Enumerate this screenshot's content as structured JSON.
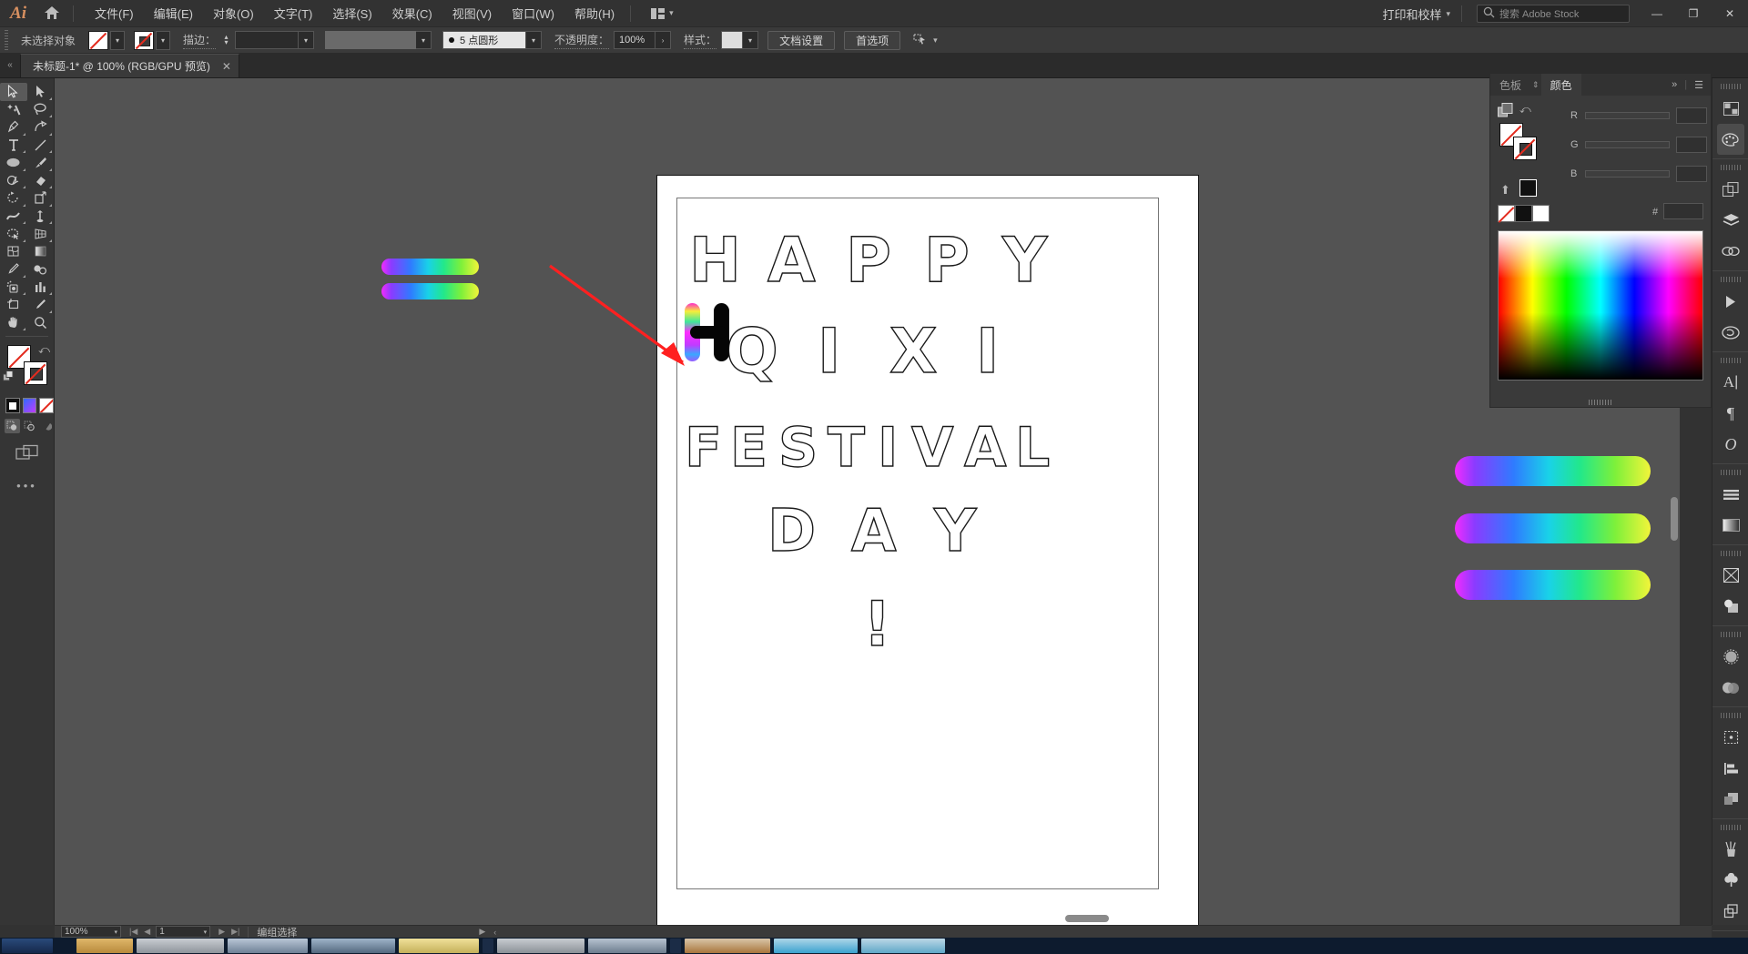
{
  "app": {
    "name": "Adobe Illustrator",
    "logo_text": "Ai"
  },
  "menubar": {
    "items": [
      {
        "label": "文件(F)",
        "name": "menu-file"
      },
      {
        "label": "编辑(E)",
        "name": "menu-edit"
      },
      {
        "label": "对象(O)",
        "name": "menu-object"
      },
      {
        "label": "文字(T)",
        "name": "menu-type"
      },
      {
        "label": "选择(S)",
        "name": "menu-select"
      },
      {
        "label": "效果(C)",
        "name": "menu-effect"
      },
      {
        "label": "视图(V)",
        "name": "menu-view"
      },
      {
        "label": "窗口(W)",
        "name": "menu-window"
      },
      {
        "label": "帮助(H)",
        "name": "menu-help"
      }
    ],
    "print_proof": "打印和校样",
    "search_placeholder": "搜索 Adobe Stock",
    "window_minimize": "—",
    "window_restore": "❐",
    "window_close": "✕"
  },
  "controlbar": {
    "selection_label": "未选择对象",
    "stroke_label": "描边：",
    "stroke_weight": "",
    "stroke_profile": "5 点圆形",
    "opacity_label": "不透明度：",
    "opacity_value": "100%",
    "style_label": "样式：",
    "document_setup": "文档设置",
    "preferences": "首选项"
  },
  "tabbar": {
    "document_title": "未标题-1* @ 100% (RGB/GPU 预览)",
    "close_glyph": "✕"
  },
  "color_panel": {
    "tabs": [
      {
        "label": "色板",
        "active": false
      },
      {
        "label": "颜色",
        "active": true
      }
    ],
    "channels": [
      {
        "label": "R",
        "value": ""
      },
      {
        "label": "G",
        "value": ""
      },
      {
        "label": "B",
        "value": ""
      }
    ],
    "hex_label": "#",
    "hex_value": "",
    "collapse_glyph": "»",
    "menu_glyph": "☰"
  },
  "artwork": {
    "lines": [
      {
        "text": "HAPPY",
        "chars": [
          "H",
          "A",
          "P",
          "P",
          "Y"
        ]
      },
      {
        "text": "QIXI",
        "chars": [
          "Q",
          "I",
          "X",
          "I"
        ]
      },
      {
        "text": "FESTIVAL",
        "chars": [
          "F",
          "E",
          "S",
          "T",
          "I",
          "V",
          "A",
          "L"
        ]
      },
      {
        "text": "DAY",
        "chars": [
          "D",
          "A",
          "Y"
        ]
      },
      {
        "text": "!",
        "chars": [
          "!"
        ]
      }
    ],
    "gradient_colors": [
      "#f32bff",
      "#8b3bff",
      "#2f7bff",
      "#19d2e8",
      "#22e88a",
      "#7ef03a",
      "#f2f53a"
    ],
    "annotation_arrow_color": "#ff2020",
    "selected_letter": "H"
  },
  "statusbar": {
    "zoom_level": "100%",
    "page_number": "1",
    "tool_status": "编组选择",
    "first_glyph": "|◀",
    "prev_glyph": "◀",
    "next_glyph": "▶",
    "last_glyph": "▶|"
  },
  "tools": {
    "left": [
      [
        "selection-tool",
        "direct-selection-tool"
      ],
      [
        "magic-wand-tool",
        "lasso-tool"
      ],
      [
        "pen-tool",
        "curvature-tool"
      ],
      [
        "type-tool",
        "line-segment-tool"
      ],
      [
        "ellipse-tool",
        "paintbrush-tool"
      ],
      [
        "shaper-tool",
        "eraser-tool"
      ],
      [
        "rotate-tool",
        "scale-tool"
      ],
      [
        "width-tool",
        "free-transform-tool"
      ],
      [
        "shape-builder-tool",
        "perspective-grid-tool"
      ],
      [
        "mesh-tool",
        "gradient-tool"
      ],
      [
        "eyedropper-tool",
        "blend-tool"
      ],
      [
        "symbol-sprayer-tool",
        "column-graph-tool"
      ],
      [
        "artboard-tool",
        "slice-tool"
      ],
      [
        "hand-tool",
        "zoom-tool"
      ]
    ],
    "fill_stroke_name": "fill-stroke-indicator",
    "more_tools_glyph": "•••"
  },
  "rail": {
    "groups": [
      [
        "swatches-panel-icon",
        "color-panel-icon"
      ],
      [
        "artboards-panel-icon",
        "layers-panel-icon",
        "links-panel-icon"
      ],
      [
        "actions-panel-icon",
        "libraries-panel-icon"
      ],
      [
        "character-panel-icon",
        "paragraph-panel-icon",
        "glyphs-panel-icon"
      ],
      [
        "align-panel-icon",
        "gradient-panel-icon"
      ],
      [
        "separate-panel-icon",
        "pathfinder-panel-icon"
      ],
      [
        "transparency-panel-icon",
        "appearance-panel-icon"
      ],
      [
        "symbols-panel-icon",
        "align-objects-icon",
        "transform-panel-icon"
      ],
      [
        "brushes-panel-icon",
        "graphic-styles-icon",
        "asset-export-icon"
      ]
    ]
  }
}
